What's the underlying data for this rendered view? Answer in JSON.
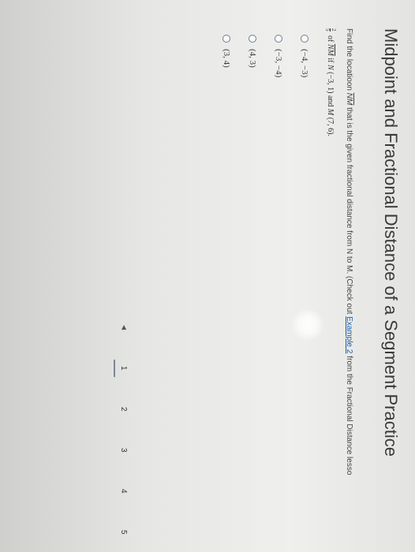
{
  "page": {
    "title": "Midpoint and Fractional Distance of a Segment Practice"
  },
  "question": {
    "text_before": "Find the locatio",
    "text_mid": "on ",
    "segment": "NM",
    "text_after": " that is the given fractional distance from N to M. (Check out ",
    "link": "Example 2",
    "text_tail": " from the Fractional Distance lesso",
    "fraction": {
      "numerator": "2",
      "denominator": "5"
    },
    "line_of": " of ",
    "line_segment": "NM",
    "line_if": " if ",
    "point_n_label": "N",
    "point_n": " (−3, 1)",
    "line_and": " and ",
    "point_m_label": "M",
    "point_m": " (7, 6)",
    "line_end": "."
  },
  "options": [
    {
      "label": "(−4, −3)"
    },
    {
      "label": "(−3, −4)"
    },
    {
      "label": "(4, 3)"
    },
    {
      "label": "(3, 4)"
    }
  ],
  "pager": {
    "prev_icon": "triangle-left-icon",
    "pages": [
      "1",
      "2",
      "3",
      "4",
      "5"
    ],
    "active_page": "1"
  }
}
